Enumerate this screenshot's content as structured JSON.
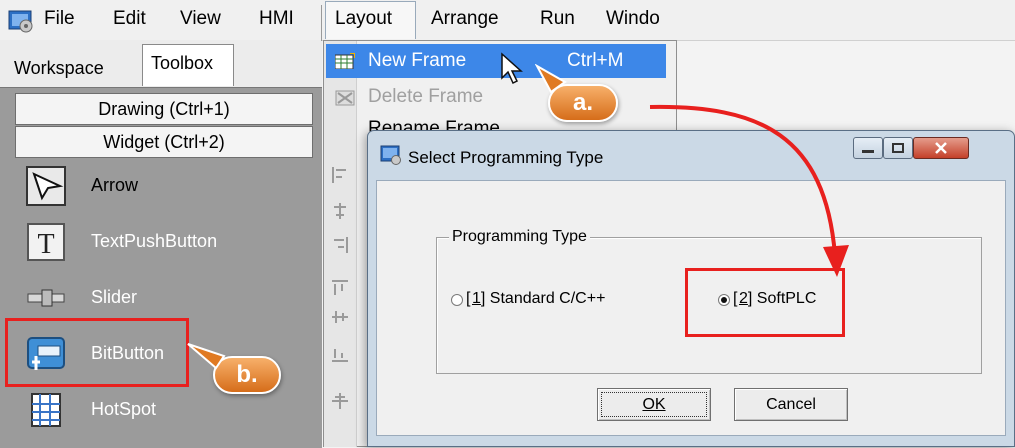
{
  "menubar": {
    "items": [
      "File",
      "Edit",
      "View",
      "HMI"
    ],
    "right_items": [
      "Layout",
      "Arrange",
      "Run",
      "Windo"
    ]
  },
  "tabs": [
    "Workspace",
    "Toolbox"
  ],
  "toolbox": {
    "headers": [
      "Drawing (Ctrl+1)",
      "Widget (Ctrl+2)"
    ],
    "tools": [
      {
        "label": "Arrow",
        "icon": "arrow-cursor-icon"
      },
      {
        "label": "TextPushButton",
        "icon": "text-button-icon"
      },
      {
        "label": "Slider",
        "icon": "slider-icon"
      },
      {
        "label": "BitButton",
        "icon": "bitbutton-icon"
      },
      {
        "label": "HotSpot",
        "icon": "hotspot-icon"
      }
    ]
  },
  "layout_menu": {
    "items": [
      {
        "label": "New Frame",
        "shortcut": "Ctrl+M"
      },
      {
        "label": "Delete Frame"
      },
      {
        "label": "Rename Frame"
      }
    ]
  },
  "dialog": {
    "title": "Select Programming Type",
    "group_label": "Programming Type",
    "options": [
      {
        "number": "1",
        "label": "Standard C/C++",
        "selected": false
      },
      {
        "number": "2",
        "label": "SoftPLC",
        "selected": true
      }
    ],
    "ok": "OK",
    "cancel": "Cancel"
  },
  "annotations": {
    "a": "a.",
    "b": "b."
  },
  "colors": {
    "highlight": "#3d87e8",
    "annotation_red": "#e8201e",
    "badge_orange": "#e07a22"
  }
}
